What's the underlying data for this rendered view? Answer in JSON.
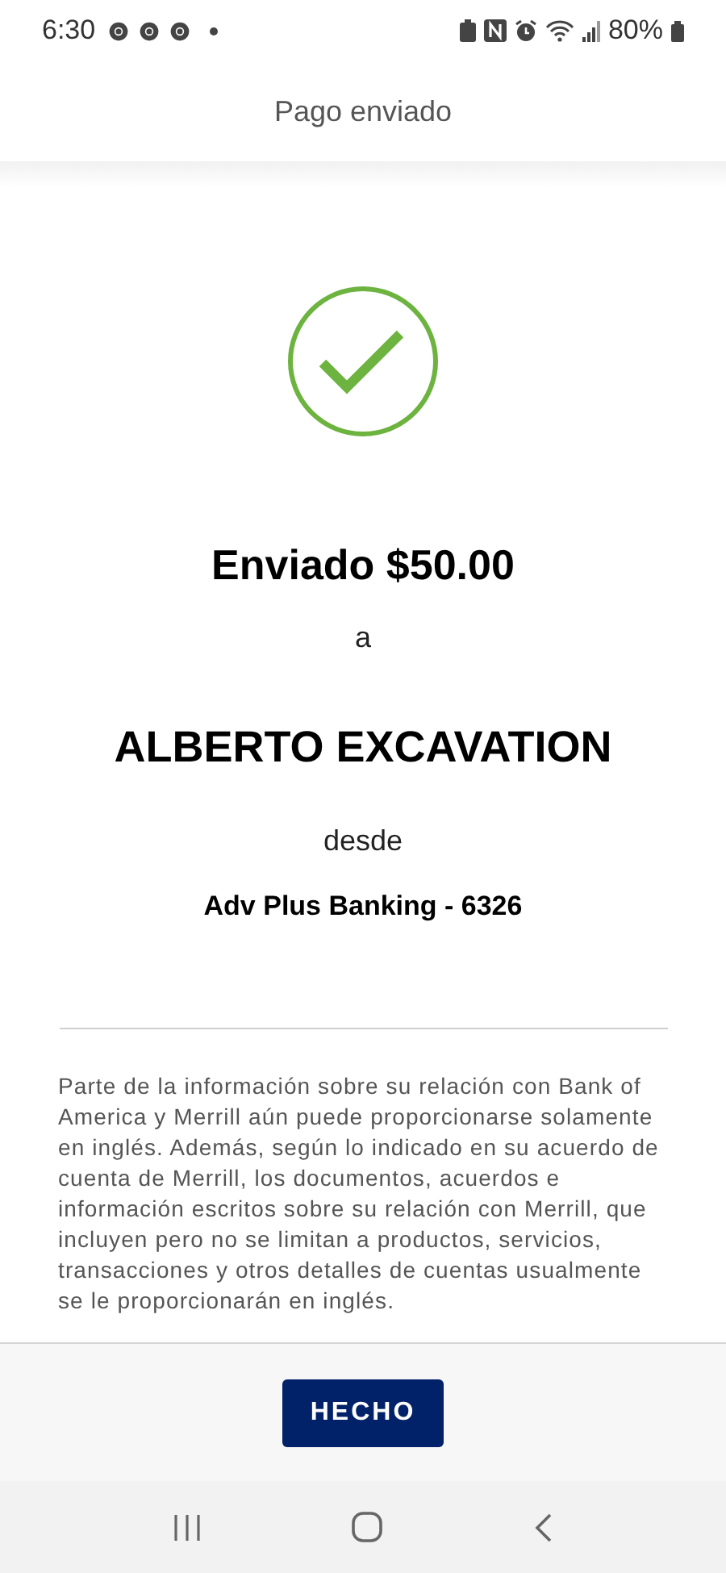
{
  "status_bar": {
    "time": "6:30",
    "battery": "80%"
  },
  "header": {
    "title": "Pago enviado"
  },
  "confirmation": {
    "amount_line": "Enviado $50.00",
    "to_word": "a",
    "recipient": "ALBERTO EXCAVATION",
    "from_word": "desde",
    "account": "Adv Plus Banking - 6326"
  },
  "disclaimer": "Parte de la información sobre su relación con Bank of America y Merrill aún puede proporcionarse solamente en inglés. Además, según lo indicado en su acuerdo de cuenta de Merrill, los documentos, acuerdos e información escritos sobre su relación con Merrill, que incluyen pero no se limitan a productos, servicios, transacciones y otros detalles de cuentas usualmente se le proporcionarán en inglés.",
  "footer": {
    "button": "HECHO"
  }
}
